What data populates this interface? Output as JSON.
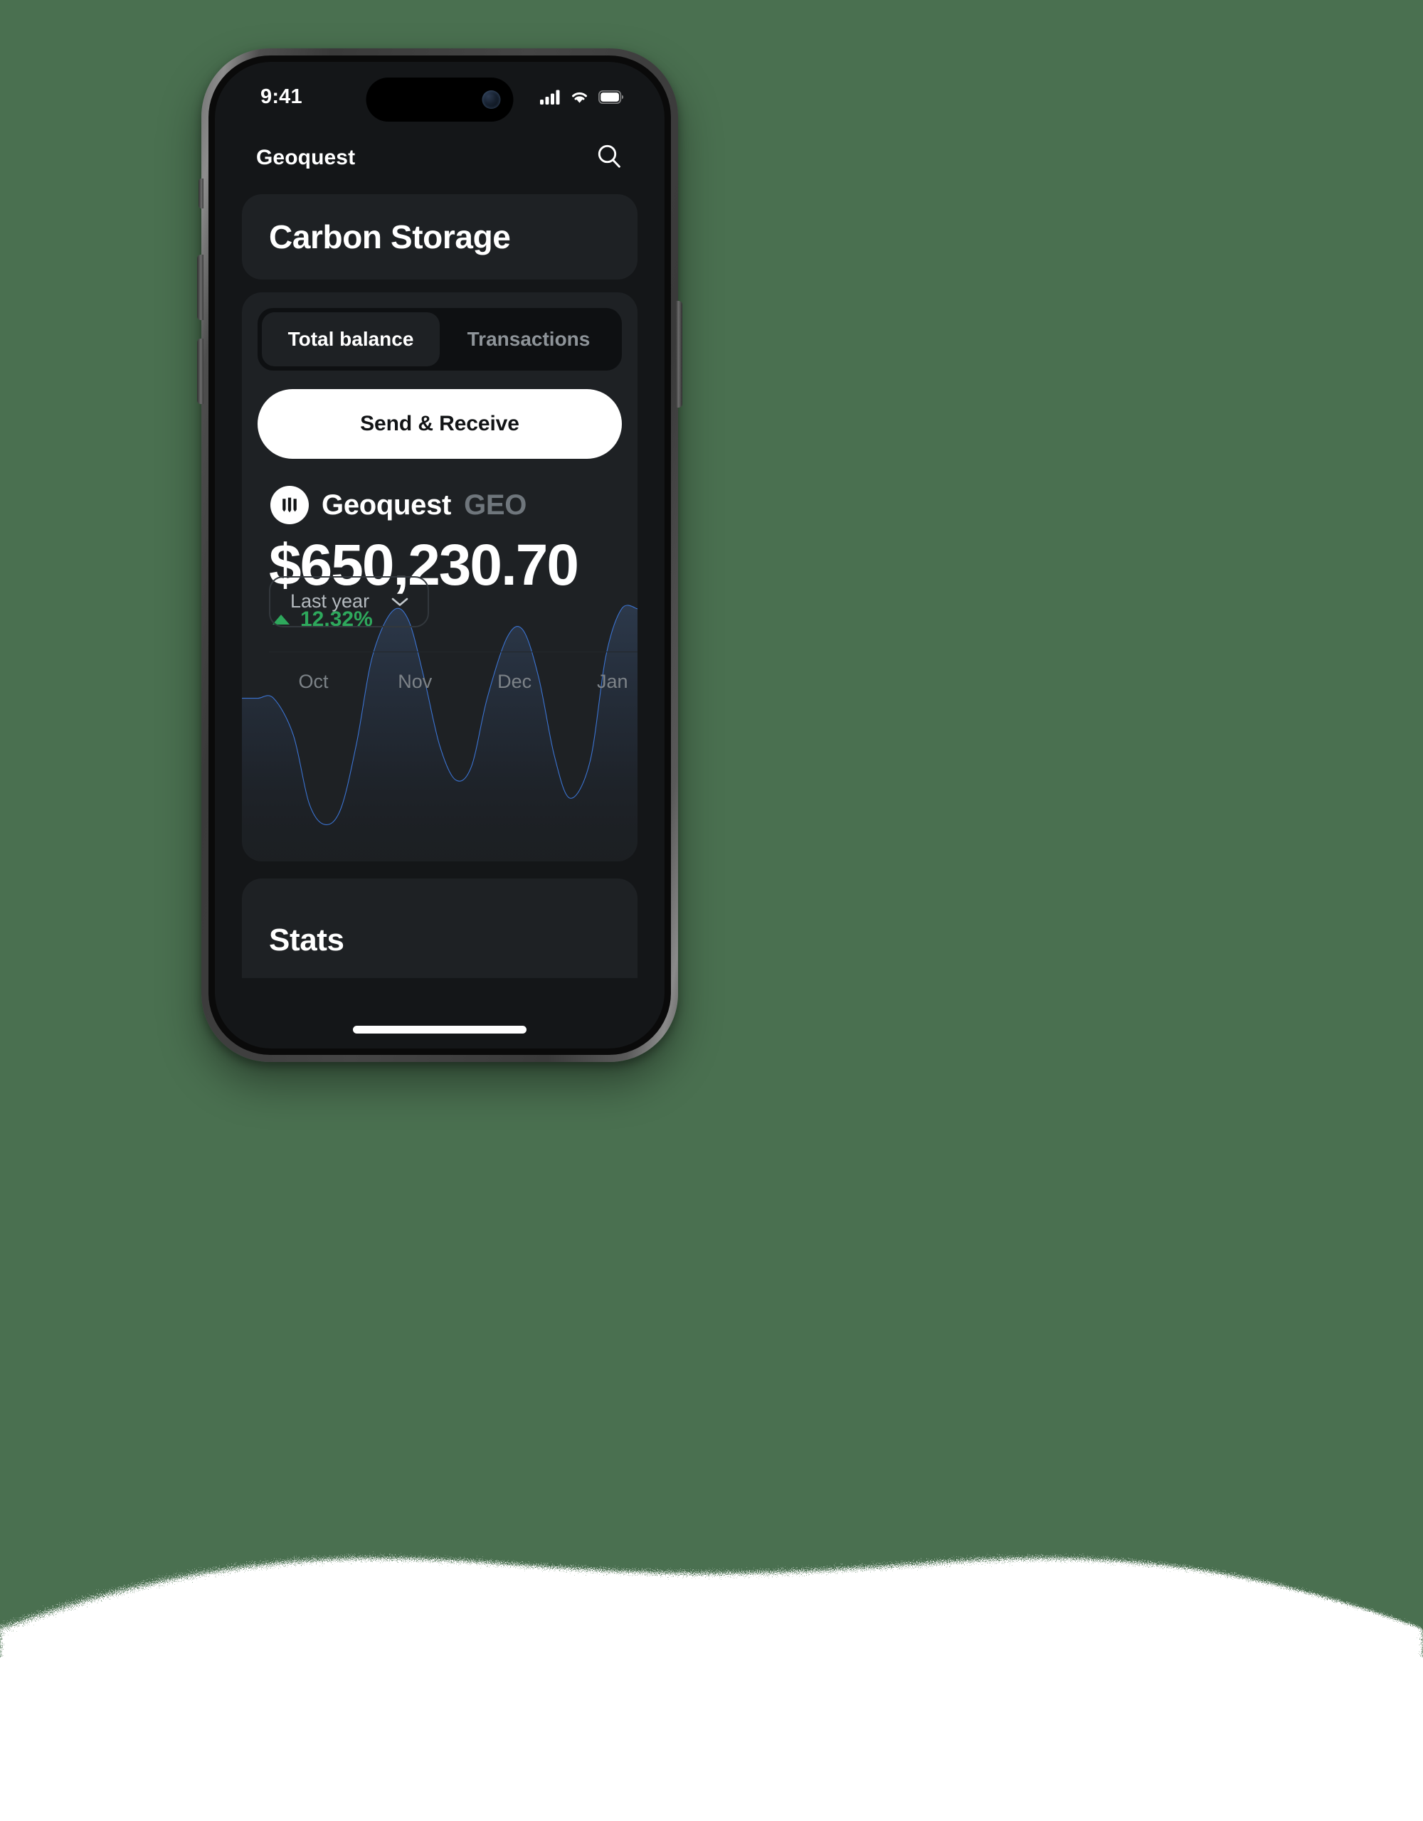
{
  "background": {
    "color": "#4a7050",
    "snow_color": "#ffffff"
  },
  "status_bar": {
    "time": "9:41",
    "icons": [
      "cellular-signal-icon",
      "wifi-icon",
      "battery-icon"
    ]
  },
  "header": {
    "app_title": "Geoquest",
    "search_icon": "search-icon"
  },
  "title_card": {
    "heading": "Carbon Storage"
  },
  "tabs": [
    {
      "label": "Total balance",
      "active": true
    },
    {
      "label": "Transactions",
      "active": false
    }
  ],
  "primary_action": {
    "label": "Send & Receive"
  },
  "token": {
    "logo_icon": "geoquest-logo-icon",
    "name": "Geoquest",
    "symbol": "GEO"
  },
  "balance": {
    "amount": "$650,230.70",
    "change_value": "12.32%",
    "change_direction_icon": "triangle-up-icon",
    "change_color": "#2ea85c"
  },
  "range_select": {
    "value": "Last year",
    "chevron_icon": "chevron-down-icon"
  },
  "stats_card": {
    "title": "Stats"
  },
  "chart_data": {
    "type": "line",
    "title": "",
    "xlabel": "",
    "ylabel": "",
    "line_color": "#3b73d1",
    "fill_gradient": [
      "#2d3a4d",
      "#171a1e"
    ],
    "grid": false,
    "legend": false,
    "categories": [
      "Oct",
      "Nov",
      "Dec",
      "Jan"
    ],
    "x_tick_positions_pct": [
      8,
      35,
      62,
      89
    ],
    "x": [
      0,
      4,
      8,
      13,
      17,
      21,
      25,
      29,
      33,
      38,
      42,
      46,
      50,
      54,
      58,
      62,
      67,
      71,
      75,
      79,
      83,
      88,
      92,
      96,
      100
    ],
    "y": [
      62,
      62,
      62,
      48,
      22,
      14,
      20,
      45,
      78,
      95,
      92,
      70,
      44,
      31,
      36,
      62,
      85,
      88,
      70,
      40,
      24,
      38,
      78,
      96,
      96
    ],
    "ylim": [
      0,
      100
    ],
    "xlim": [
      0,
      100
    ]
  }
}
